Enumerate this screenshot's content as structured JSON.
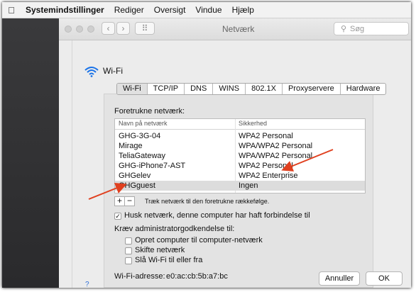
{
  "menubar": {
    "apple": "",
    "items": [
      "Systemindstillinger",
      "Rediger",
      "Oversigt",
      "Vindue",
      "Hjælp"
    ]
  },
  "window": {
    "title": "Netværk",
    "search_placeholder": "Søg",
    "nav_back": "‹",
    "nav_forward": "›",
    "grid": "⠿"
  },
  "wifi": {
    "title": "Wi-Fi"
  },
  "tabs": [
    "Wi-Fi",
    "TCP/IP",
    "DNS",
    "WINS",
    "802.1X",
    "Proxyservere",
    "Hardware"
  ],
  "preferred": {
    "label": "Foretrukne netværk:",
    "col_name": "Navn på netværk",
    "col_security": "Sikkerhed",
    "rows": [
      {
        "name": "GHG-3G-04",
        "security": "WPA2 Personal"
      },
      {
        "name": "Mirage",
        "security": "WPA/WPA2 Personal"
      },
      {
        "name": "TeliaGateway",
        "security": "WPA/WPA2 Personal"
      },
      {
        "name": "GHG-iPhone7-AST",
        "security": "WPA2 Personal"
      },
      {
        "name": "GHGelev",
        "security": "WPA2 Enterprise"
      },
      {
        "name": "GHGguest",
        "security": "Ingen"
      }
    ],
    "add": "+",
    "remove": "−",
    "drag_hint": "Træk netværk til den foretrukne rækkefølge."
  },
  "options": {
    "remember": "Husk netværk, denne computer har haft forbindelse til",
    "remember_checked": "✓",
    "admin_label": "Kræv administratorgodkendelse til:",
    "admin_items": [
      "Opret computer til computer-netværk",
      "Skifte netværk",
      "Slå Wi-Fi til eller fra"
    ]
  },
  "address": {
    "label": "Wi-Fi-adresse:",
    "value": "e0:ac:cb:5b:a7:bc"
  },
  "buttons": {
    "cancel": "Annuller",
    "ok": "OK"
  },
  "help": "?",
  "colors": {
    "annotation_arrow": "#e0401f",
    "wifi_icon": "#1a73e8"
  }
}
